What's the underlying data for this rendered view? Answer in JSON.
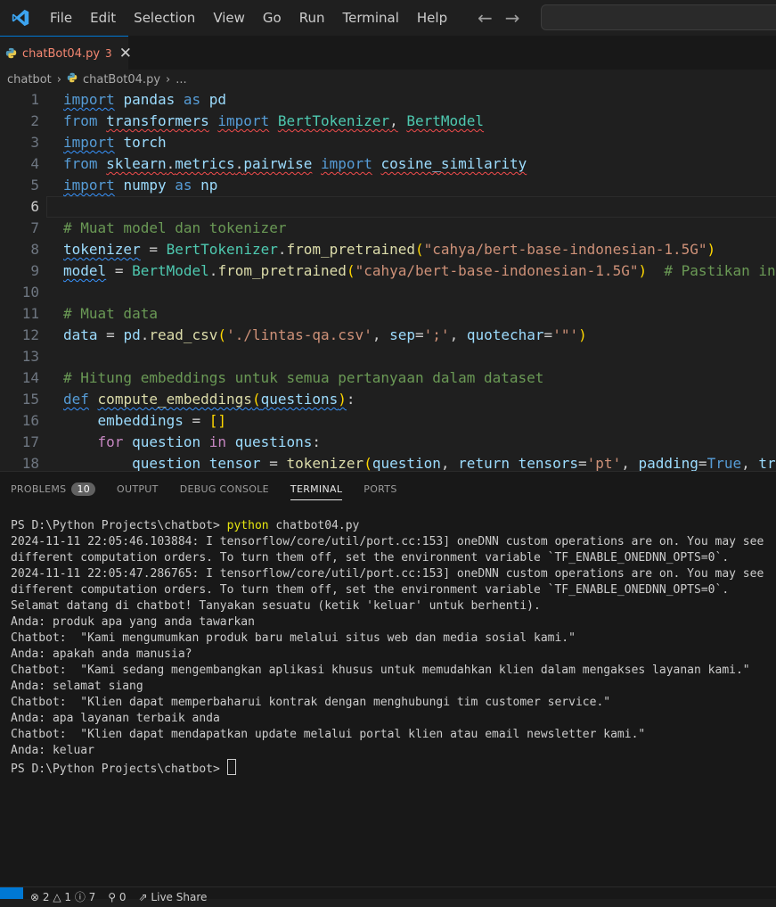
{
  "menu": [
    "File",
    "Edit",
    "Selection",
    "View",
    "Go",
    "Run",
    "Terminal",
    "Help"
  ],
  "nav": {
    "back": "←",
    "forward": "→"
  },
  "tab": {
    "name": "chatBot04.py",
    "problems": "3",
    "close": "✕"
  },
  "breadcrumb": {
    "folder": "chatbot",
    "file": "chatBot04.py",
    "more": "..."
  },
  "editor": {
    "line_numbers": [
      "1",
      "2",
      "3",
      "4",
      "5",
      "6",
      "7",
      "8",
      "9",
      "10",
      "11",
      "12",
      "13",
      "14",
      "15",
      "16",
      "17",
      "18"
    ],
    "lines": [
      "import pandas as pd",
      "from transformers import BertTokenizer, BertModel",
      "import torch",
      "from sklearn.metrics.pairwise import cosine_similarity",
      "import numpy as np",
      "",
      "# Muat model dan tokenizer",
      "tokenizer = BertTokenizer.from_pretrained(\"cahya/bert-base-indonesian-1.5G\")",
      "model = BertModel.from_pretrained(\"cahya/bert-base-indonesian-1.5G\")  # Pastikan in",
      "",
      "# Muat data",
      "data = pd.read_csv('./lintas-qa.csv', sep=';', quotechar='\"')",
      "",
      "# Hitung embeddings untuk semua pertanyaan dalam dataset",
      "def compute_embeddings(questions):",
      "    embeddings = []",
      "    for question in questions:",
      "        question_tensor = tokenizer(question, return_tensors='pt', padding=True, tr"
    ]
  },
  "panel": {
    "tabs": [
      "PROBLEMS",
      "OUTPUT",
      "DEBUG CONSOLE",
      "TERMINAL",
      "PORTS"
    ],
    "problems_count": "10",
    "active_tab": "TERMINAL"
  },
  "terminal": {
    "lines": [
      "PS D:\\Python Projects\\chatbot> python chatbot04.py",
      "2024-11-11 22:05:46.103884: I tensorflow/core/util/port.cc:153] oneDNN custom operations are on. You may see",
      "different computation orders. To turn them off, set the environment variable `TF_ENABLE_ONEDNN_OPTS=0`.",
      "2024-11-11 22:05:47.286765: I tensorflow/core/util/port.cc:153] oneDNN custom operations are on. You may see",
      "different computation orders. To turn them off, set the environment variable `TF_ENABLE_ONEDNN_OPTS=0`.",
      "Selamat datang di chatbot! Tanyakan sesuatu (ketik 'keluar' untuk berhenti).",
      "Anda: produk apa yang anda tawarkan",
      "Chatbot:  \"Kami mengumumkan produk baru melalui situs web dan media sosial kami.\"",
      "Anda: apakah anda manusia?",
      "Chatbot:  \"Kami sedang mengembangkan aplikasi khusus untuk memudahkan klien dalam mengakses layanan kami.\"",
      "Anda: selamat siang",
      "Chatbot:  \"Klien dapat memperbaharui kontrak dengan menghubungi tim customer service.\"",
      "Anda: apa layanan terbaik anda",
      "Chatbot:  \"Klien dapat mendapatkan update melalui portal klien atau email newsletter kami.\"",
      "Anda: keluar"
    ],
    "prompt": "PS D:\\Python Projects\\chatbot> ",
    "first_prompt": "PS D:\\Python Projects\\chatbot> ",
    "first_cmd_word": "python",
    "first_cmd_rest": " chatbot04.py"
  },
  "status": {
    "errors": "2",
    "warnings": "1",
    "info": "7",
    "ports": "0",
    "live_share": "Live Share"
  },
  "colors": {
    "accent": "#0078d4",
    "tab_error": "#f48771"
  }
}
